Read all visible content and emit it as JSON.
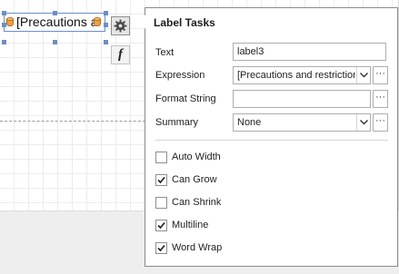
{
  "designer": {
    "label_text": "[Precautions and restrictions]",
    "expression_button_glyph": "f"
  },
  "label_tasks": {
    "title": "Label Tasks",
    "text": {
      "label": "Text",
      "value": "label3"
    },
    "expression": {
      "label": "Expression",
      "value": "[Precautions and restrictions]"
    },
    "format_string": {
      "label": "Format String",
      "value": ""
    },
    "summary": {
      "label": "Summary",
      "value": "None"
    },
    "ellipsis": "···",
    "options": [
      {
        "label": "Auto Width",
        "checked": false
      },
      {
        "label": "Can Grow",
        "checked": true
      },
      {
        "label": "Can Shrink",
        "checked": false
      },
      {
        "label": "Multiline",
        "checked": true
      },
      {
        "label": "Word Wrap",
        "checked": true
      }
    ]
  },
  "icons": {
    "smart_tag": "gear-icon",
    "expression": "function-icon",
    "dropdown": "chevron-down-icon",
    "field_source": "database-icon"
  },
  "colors": {
    "selection": "#6b8fc4",
    "panel_border": "#8a8a8a",
    "database_icon": "#e8a24b"
  }
}
